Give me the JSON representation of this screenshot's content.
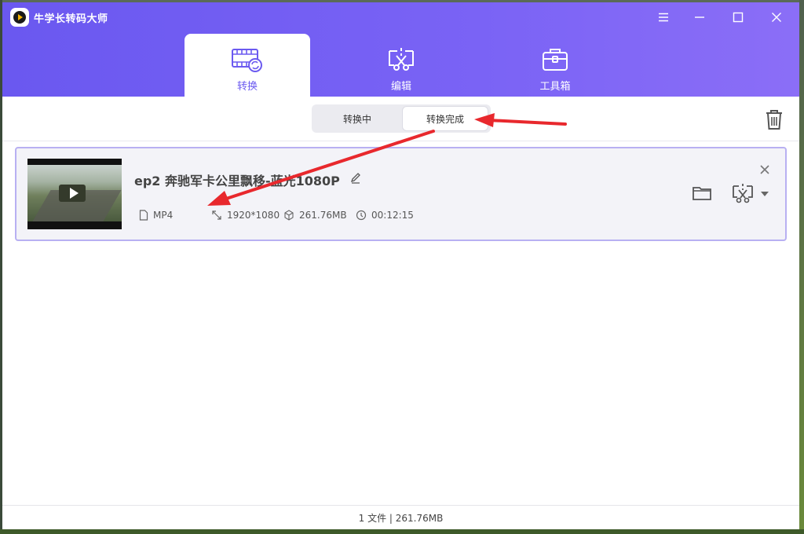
{
  "app": {
    "title": "牛学长转码大师"
  },
  "window_controls": {
    "menu_icon": "hamburger-icon",
    "minimize_icon": "minimize-icon",
    "maximize_icon": "maximize-icon",
    "close_icon": "close-icon"
  },
  "nav": {
    "tabs": [
      {
        "label": "转换",
        "icon": "film-convert-icon",
        "active": true
      },
      {
        "label": "编辑",
        "icon": "scissors-edit-icon",
        "active": false
      },
      {
        "label": "工具箱",
        "icon": "toolbox-icon",
        "active": false
      }
    ]
  },
  "toolbar": {
    "segments": [
      {
        "label": "转换中",
        "active": false
      },
      {
        "label": "转换完成",
        "active": true
      }
    ],
    "trash_icon": "trash-icon"
  },
  "files": [
    {
      "title": "ep2 奔驰军卡公里飘移-蓝光1080P",
      "format": "MP4",
      "resolution": "1920*1080",
      "size": "261.76MB",
      "duration": "00:12:15"
    }
  ],
  "status": {
    "summary": "1 文件 | 261.76MB"
  },
  "colors": {
    "header_start": "#6a58f0",
    "header_end": "#8b6ef7",
    "accent": "#6b5af0",
    "card_border": "#b8b0f2",
    "annotation_arrow": "#e8282d"
  }
}
